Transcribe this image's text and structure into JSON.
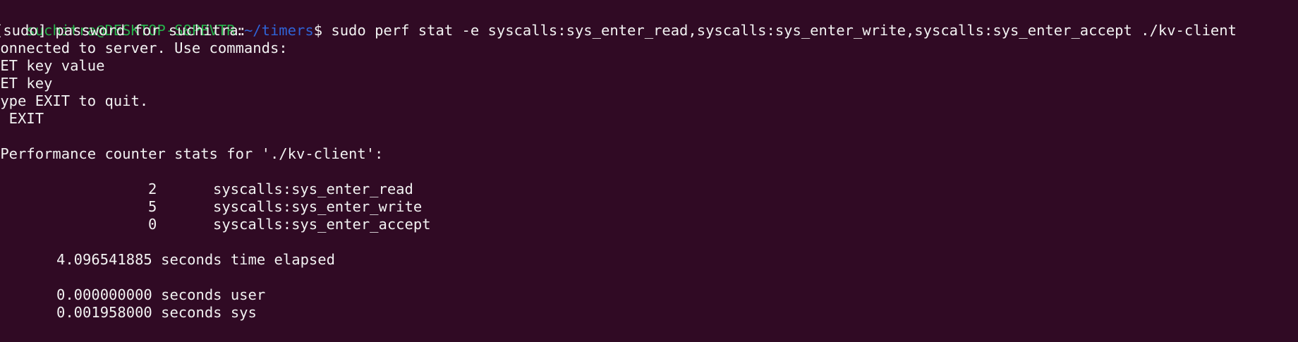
{
  "colors": {
    "background": "#300a24",
    "foreground": "#f2f2f2",
    "prompt_user": "#26b04a",
    "prompt_path": "#2f63d6"
  },
  "prompt": {
    "user_host": "suchitra@DESKTOP-S8PBVTR",
    "separator": ":",
    "path": "~/timers",
    "symbol": "$ ",
    "command": "sudo perf stat -e syscalls:sys_enter_read,syscalls:sys_enter_write,syscalls:sys_enter_accept ./kv-client"
  },
  "output": {
    "sudo_prompt": "[sudo] password for suchitra:",
    "connected": "Connected to server. Use commands:",
    "cmd_set": "SET key value",
    "cmd_get": "GET key",
    "exit_hint": "Type EXIT to quit.",
    "exit_input": "> EXIT",
    "stats_header": " Performance counter stats for './kv-client':",
    "counters": [
      {
        "count": "2",
        "event": "syscalls:sys_enter_read"
      },
      {
        "count": "5",
        "event": "syscalls:sys_enter_write"
      },
      {
        "count": "0",
        "event": "syscalls:sys_enter_accept"
      }
    ],
    "time_elapsed": "4.096541885 seconds time elapsed",
    "time_user": "0.000000000 seconds user",
    "time_sys": "0.001958000 seconds sys"
  }
}
